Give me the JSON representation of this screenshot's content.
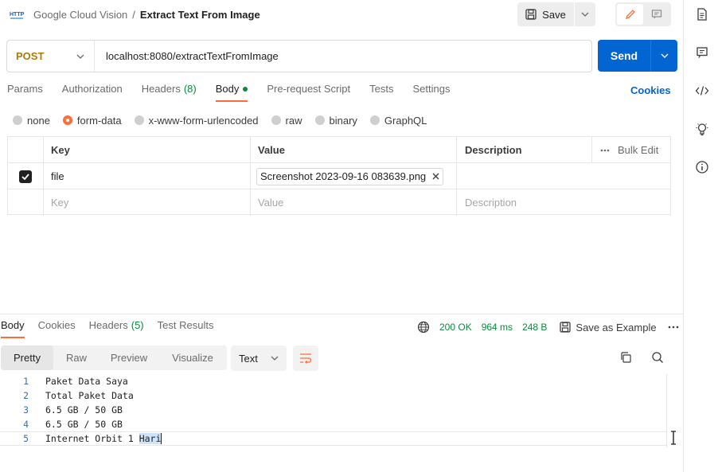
{
  "header": {
    "collection": "Google Cloud Vision",
    "separator": "/",
    "request_name": "Extract Text From Image",
    "save_label": "Save"
  },
  "request": {
    "method": "POST",
    "url": "localhost:8080/extractTextFromImage",
    "send_label": "Send"
  },
  "tabs": {
    "params": "Params",
    "authorization": "Authorization",
    "headers": "Headers",
    "headers_count": "(8)",
    "body": "Body",
    "pre_request": "Pre-request Script",
    "tests": "Tests",
    "settings": "Settings",
    "cookies": "Cookies"
  },
  "body_types": {
    "none": "none",
    "form_data": "form-data",
    "urlencoded": "x-www-form-urlencoded",
    "raw": "raw",
    "binary": "binary",
    "graphql": "GraphQL",
    "selected": "form-data"
  },
  "form_table": {
    "headers": {
      "key": "Key",
      "value": "Value",
      "description": "Description",
      "bulk_edit": "Bulk Edit"
    },
    "rows": [
      {
        "checked": true,
        "key": "file",
        "value": "Screenshot 2023-09-16 083639.png",
        "description": ""
      }
    ],
    "placeholder": {
      "key": "Key",
      "value": "Value",
      "description": "Description"
    }
  },
  "response": {
    "tabs": {
      "body": "Body",
      "cookies": "Cookies",
      "headers": "Headers",
      "headers_count": "(5)",
      "test_results": "Test Results"
    },
    "status": "200 OK",
    "time": "964 ms",
    "size": "248 B",
    "save_example": "Save as Example",
    "views": {
      "pretty": "Pretty",
      "raw": "Raw",
      "preview": "Preview",
      "visualize": "Visualize"
    },
    "format": "Text",
    "lines": [
      {
        "n": "1",
        "text": "Paket Data Saya"
      },
      {
        "n": "2",
        "text": "Total Paket Data"
      },
      {
        "n": "3",
        "text": "6.5 GB / 50 GB"
      },
      {
        "n": "4",
        "text": "6.5 GB / 50 GB"
      },
      {
        "n": "5",
        "text_a": "Internet Orbit 1 ",
        "text_b": "Hari"
      }
    ]
  },
  "colors": {
    "accent": "#ff6c37",
    "send": "#0265d2",
    "method_post": "#ad7a03",
    "status_ok": "#0a8a3c"
  },
  "icons": [
    "http-icon",
    "save-icon",
    "chevron-down-icon",
    "pencil-icon",
    "comment-icon",
    "document-icon",
    "code-icon",
    "bulb-icon",
    "info-icon",
    "globe-icon",
    "close-icon",
    "more-icon",
    "wrap-icon",
    "copy-icon",
    "search-icon",
    "check-icon"
  ]
}
